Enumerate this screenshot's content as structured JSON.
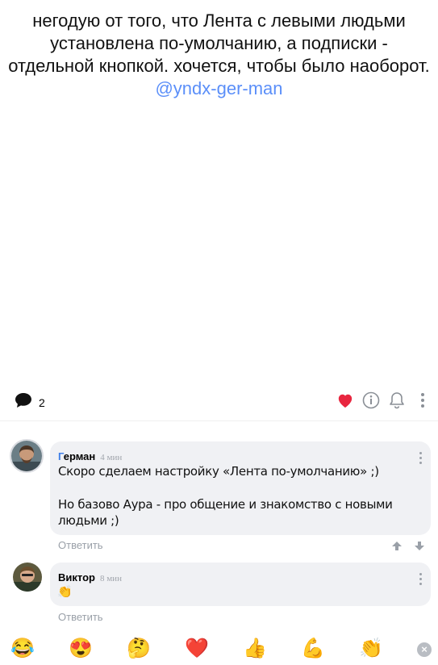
{
  "post": {
    "text": "негодую от того, что Лента с левыми людьми установлена по-умолчанию, а подписки - отдельной кнопкой. хочется, чтобы было наоборот.",
    "mention": "@yndx-ger-man"
  },
  "actions": {
    "comments_count": "2"
  },
  "comments": [
    {
      "author_first": "Г",
      "author_rest": "ерман",
      "time": "4 мин",
      "lines": [
        "Скоро сделаем настройку «Лента по-умолчанию» ;)",
        "Но базово Аура - про общение и знакомство с новыми людьми ;)"
      ],
      "reply_label": "Ответить"
    },
    {
      "author": "Виктор",
      "time": "8 мин",
      "text": "👏",
      "reply_label": "Ответить"
    }
  ],
  "reactions": [
    "😂",
    "😍",
    "🤔",
    "❤️",
    "👍",
    "💪",
    "👏"
  ],
  "colors": {
    "accent": "#3f7fe8",
    "mention": "#5b8ff9",
    "heart": "#e8263f",
    "bubble": "#f0f1f4"
  }
}
